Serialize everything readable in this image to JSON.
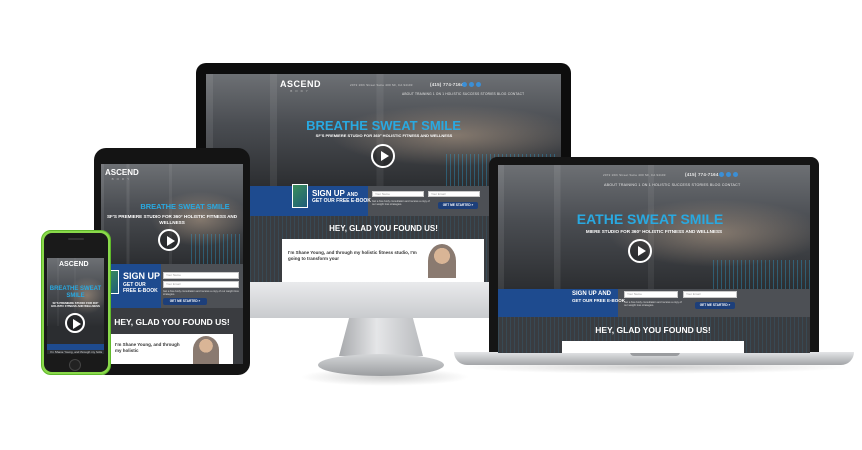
{
  "site": {
    "logo_main": "ASCEND",
    "logo_sub": "BODY",
    "address": "2072 16th Street Suite 400 SF, CA 94103",
    "address_short": "2072 16th Street Suite 400 SF, CA 94103",
    "phone": "(415) 774-7164",
    "nav": [
      "ABOUT",
      "TRAINING",
      "1 ON 1",
      "HOLISTIC",
      "SUCCESS STORIES",
      "BLOG",
      "CONTACT"
    ],
    "nav_line": "ABOUT   TRAINING   1 ON 1   HOLISTIC   SUCCESS STORIES   BLOG   CONTACT",
    "nav_line_mb": "TRAINING   1 ON 1   HOLISTIC   SUCCESS STORIES   BLOG   CONTACT",
    "hero_title": "BREATHE SWEAT SMILE",
    "hero_title_mb": "EATHE SWEAT SMILE",
    "hero_subtitle": "SF'S PREMIERE STUDIO FOR 360° HOLISTIC FITNESS AND WELLNESS",
    "hero_subtitle_mb": "MIERE STUDIO FOR 360° HOLISTIC FITNESS AND WELLNESS",
    "signup_line1": "SIGN UP",
    "signup_line2": "AND",
    "signup_line3": "GET OUR FREE E-BOOK",
    "signup_line2_mb": "SIGN UP AND",
    "signup_line3_mb": "GET OUR FREE E-BOOK",
    "signup_small": "Get a free body consultation and receive a copy of our weight loss strategies.",
    "name_placeholder": "Your Name",
    "email_placeholder": "Your Email",
    "cta_label": "GET ME STARTED »",
    "hey_title": "HEY, GLAD YOU FOUND US!",
    "intro_text": "I'm Shane Young, and through my holistic fitness studio, I'm going to transform your",
    "intro_text_ipad": "I'm Shane Young, and through my holistic",
    "intro_text_phone": "I'm Shane Young, and through my holistic"
  },
  "colors": {
    "accent_blue": "#29a9e1",
    "navy": "#1d3f7a",
    "iphone_green": "#8ad94b"
  },
  "icons": [
    "facebook-icon",
    "twitter-icon",
    "instagram-icon",
    "play-icon"
  ]
}
